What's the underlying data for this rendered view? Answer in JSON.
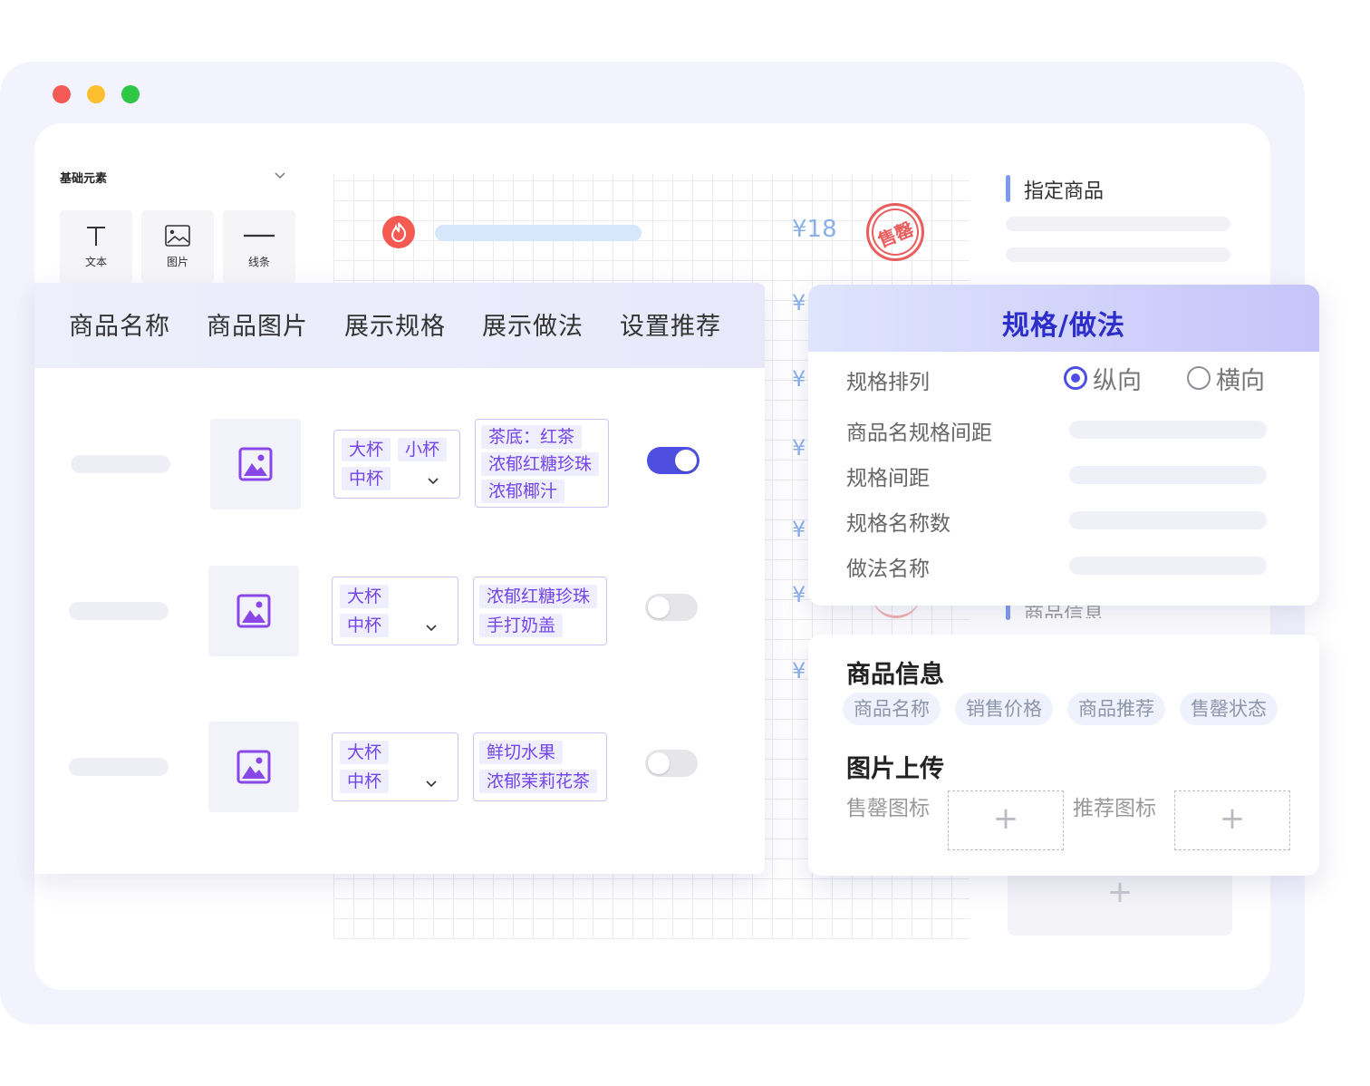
{
  "left_panel": {
    "title": "基础元素",
    "tools": [
      {
        "label": "文本",
        "icon": "text-icon"
      },
      {
        "label": "图片",
        "icon": "image-icon"
      },
      {
        "label": "线条",
        "icon": "line-icon"
      }
    ]
  },
  "canvas": {
    "price": "¥18",
    "stamp_text": "售罄",
    "currency_symbol": "¥"
  },
  "right_panel": {
    "section1_title": "指定商品",
    "section2_title": "商品信息"
  },
  "product_table": {
    "headers": [
      "商品名称",
      "商品图片",
      "展示规格",
      "展示做法",
      "设置推荐"
    ],
    "rows": [
      {
        "specs": [
          "大杯",
          "小杯",
          "中杯"
        ],
        "methods": [
          "茶底：红茶",
          "浓郁红糖珍珠",
          "浓郁椰汁"
        ],
        "recommend": true
      },
      {
        "specs": [
          "大杯",
          "中杯"
        ],
        "methods": [
          "浓郁红糖珍珠",
          "手打奶盖"
        ],
        "recommend": false
      },
      {
        "specs": [
          "大杯",
          "中杯"
        ],
        "methods": [
          "鲜切水果",
          "浓郁茉莉花茶"
        ],
        "recommend": false
      }
    ]
  },
  "spec_settings": {
    "title": "规格/做法",
    "arrangement_label": "规格排列",
    "options": [
      "纵向",
      "横向"
    ],
    "selected_option": "纵向",
    "rows": [
      "商品名规格间距",
      "规格间距",
      "规格名称数",
      "做法名称"
    ]
  },
  "product_info": {
    "title": "商品信息",
    "fields": [
      "商品名称",
      "销售价格",
      "商品推荐",
      "售罄状态"
    ],
    "upload_title": "图片上传",
    "uploads": [
      "售罄图标",
      "推荐图标"
    ],
    "plus": "+"
  },
  "colors": {
    "accent": "#4e4fe0",
    "tag_text": "#7345e6",
    "price_blue": "#8ab0ea",
    "stamp_red": "#ea5d5d"
  }
}
